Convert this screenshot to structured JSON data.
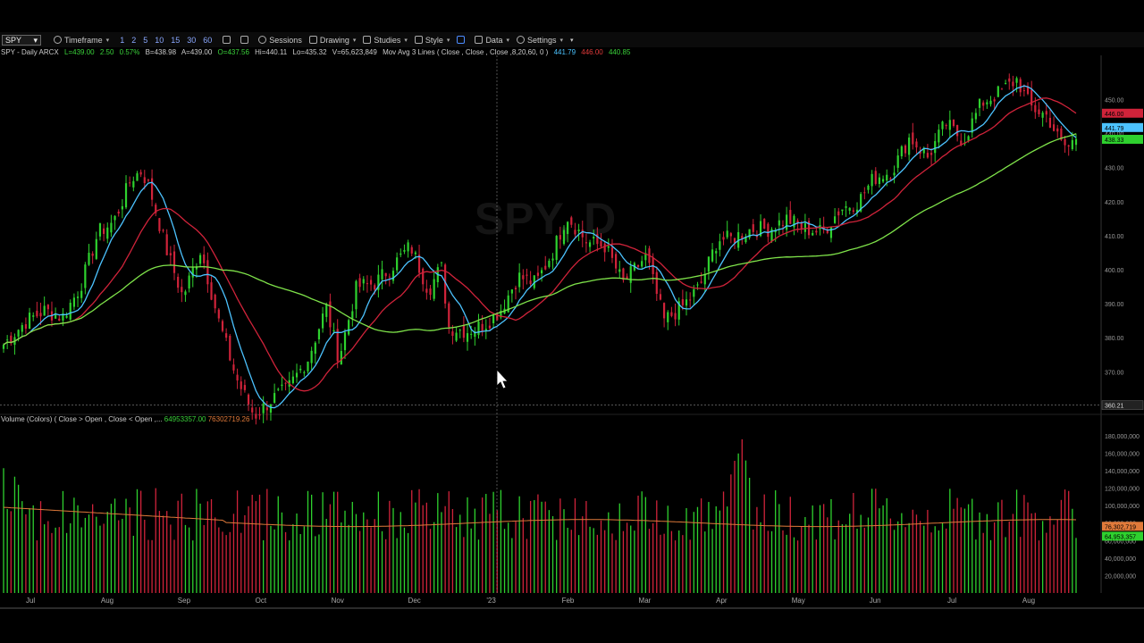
{
  "toolbar": {
    "symbol": "SPY",
    "timeframe_label": "Timeframe",
    "quick_intervals": [
      "1",
      "2",
      "5",
      "10",
      "15",
      "30",
      "60"
    ],
    "sessions_label": "Sessions",
    "drawing_label": "Drawing",
    "studies_label": "Studies",
    "style_label": "Style",
    "data_label": "Data",
    "settings_label": "Settings"
  },
  "info_line": {
    "symbol_desc": "SPY - Daily  ARCX",
    "last": "L=439.00",
    "change": "2.50",
    "change_pct": "0.57%",
    "bid": "B=438.98",
    "ask": "A=439.00",
    "open": "O=437.56",
    "high": "Hi=440.11",
    "low": "Lo=435.32",
    "volume": "V=65,623,849",
    "study": "Mov Avg 3 Lines ( Close , Close , Close ,8,20,60, 0 )",
    "ma_fast": "441.79",
    "ma_mid": "446.00",
    "ma_slow": "440.85"
  },
  "volume_info": {
    "label": "Volume (Colors) ( Close > Open , Close < Open ,...",
    "value_up": "64953357.00",
    "value_avg": "76302719.26"
  },
  "colors": {
    "up": "#2ed12e",
    "down": "#d0233a",
    "ma_fast": "#4cc3ff",
    "ma_mid": "#d0233a",
    "ma_slow": "#7fe34a",
    "vol_avg": "#e07a3a",
    "background": "#000000"
  },
  "chart_data": [
    {
      "type": "candlestick",
      "title": "SPY - Daily ARCX",
      "x_tick_labels": [
        "Jul",
        "Aug",
        "Sep",
        "Oct",
        "Nov",
        "Dec",
        "'23",
        "Feb",
        "Mar",
        "Apr",
        "May",
        "Jun",
        "Jul",
        "Aug"
      ],
      "y_tick_labels": [
        "370.00",
        "380.00",
        "390.00",
        "400.00",
        "410.00",
        "420.00",
        "430.00",
        "440.00",
        "450.00"
      ],
      "ylim": [
        358,
        463
      ],
      "price_markers": [
        {
          "label": "446.00",
          "value": 446.0,
          "color": "#d0233a"
        },
        {
          "label": "441.79",
          "value": 441.79,
          "color": "#4cc3ff"
        },
        {
          "label": "438.33",
          "value": 438.33,
          "color": "#2ed12e"
        }
      ],
      "crosshair_label": "360.21",
      "close_path": [
        [
          "Jun 22",
          378
        ],
        [
          "Jun 27",
          382
        ],
        [
          "Jul 1",
          385
        ],
        [
          "Jul 8",
          388
        ],
        [
          "Jul 15",
          386
        ],
        [
          "Jul 22",
          395
        ],
        [
          "Jul 29",
          411
        ],
        [
          "Aug 5",
          414
        ],
        [
          "Aug 12",
          427
        ],
        [
          "Aug 16",
          429
        ],
        [
          "Aug 19",
          424
        ],
        [
          "Aug 26",
          405
        ],
        [
          "Sep 2",
          392
        ],
        [
          "Sep 9",
          406
        ],
        [
          "Sep 13",
          394
        ],
        [
          "Sep 16",
          385
        ],
        [
          "Sep 23",
          368
        ],
        [
          "Sep 30",
          357
        ],
        [
          "Oct 7",
          362
        ],
        [
          "Oct 13",
          365
        ],
        [
          "Oct 21",
          374
        ],
        [
          "Oct 28",
          389
        ],
        [
          "Nov 3",
          374
        ],
        [
          "Nov 10",
          395
        ],
        [
          "Nov 17",
          396
        ],
        [
          "Nov 25",
          402
        ],
        [
          "Dec 1",
          407
        ],
        [
          "Dec 8",
          394
        ],
        [
          "Dec 13",
          401
        ],
        [
          "Dec 16",
          383
        ],
        [
          "Dec 23",
          382
        ],
        [
          "Dec 30",
          384
        ],
        [
          "Jan 6",
          388
        ],
        [
          "Jan 13",
          398
        ],
        [
          "Jan 20",
          396
        ],
        [
          "Jan 27",
          406
        ],
        [
          "Feb 2",
          416
        ],
        [
          "Feb 10",
          408
        ],
        [
          "Feb 17",
          407
        ],
        [
          "Feb 24",
          396
        ],
        [
          "Mar 3",
          404
        ],
        [
          "Mar 10",
          385
        ],
        [
          "Mar 17",
          389
        ],
        [
          "Mar 24",
          395
        ],
        [
          "Mar 31",
          409
        ],
        [
          "Apr 6",
          409
        ],
        [
          "Apr 14",
          412
        ],
        [
          "Apr 21",
          412
        ],
        [
          "Apr 28",
          415
        ],
        [
          "May 5",
          412
        ],
        [
          "May 12",
          411
        ],
        [
          "May 19",
          418
        ],
        [
          "May 26",
          420
        ],
        [
          "Jun 2",
          427
        ],
        [
          "Jun 9",
          429
        ],
        [
          "Jun 16",
          439
        ],
        [
          "Jun 23",
          433
        ],
        [
          "Jun 30",
          443
        ],
        [
          "Jul 7",
          438
        ],
        [
          "Jul 14",
          449
        ],
        [
          "Jul 21",
          452
        ],
        [
          "Jul 28",
          456
        ],
        [
          "Aug 3",
          448
        ],
        [
          "Aug 10",
          445
        ],
        [
          "Aug 15",
          437
        ],
        [
          "Aug 18",
          436
        ],
        [
          "Aug 21",
          439
        ]
      ],
      "series": [
        {
          "name": "MA 8",
          "color": "#4cc3ff"
        },
        {
          "name": "MA 20",
          "color": "#d0233a"
        },
        {
          "name": "MA 60",
          "color": "#7fe34a"
        }
      ]
    },
    {
      "type": "bar",
      "title": "Volume (Colors)",
      "y_tick_labels": [
        "20,000,000",
        "40,000,000",
        "60,000,000",
        "80,000,000",
        "100,000,000",
        "120,000,000",
        "140,000,000",
        "160,000,000",
        "180,000,000"
      ],
      "ylim": [
        0,
        190000000
      ],
      "markers": [
        {
          "label": "76,302,719",
          "value": 76302719,
          "color": "#e07a3a"
        },
        {
          "label": "64,953,357",
          "value": 64953357,
          "color": "#2ed12e"
        }
      ],
      "avg_series_name": "Volume average"
    }
  ]
}
